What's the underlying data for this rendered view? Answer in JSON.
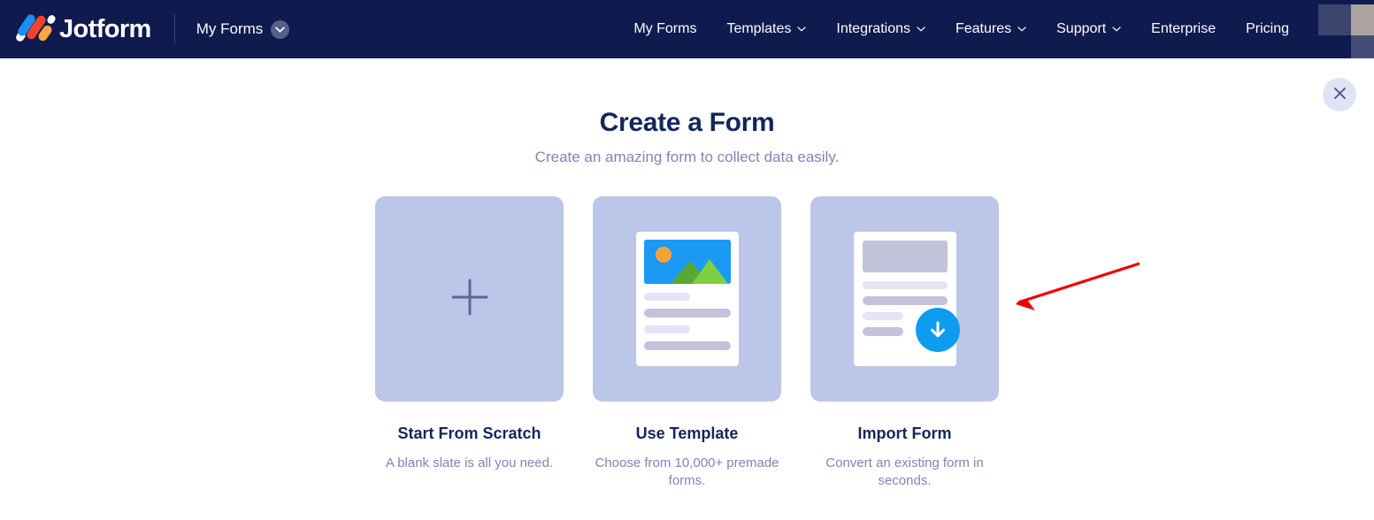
{
  "header": {
    "brand_name": "Jotform",
    "logo_icon": "jotform-logo-icon",
    "my_forms_label": "My Forms",
    "my_forms_chevron_icon": "chevron-down-icon",
    "avatar": "censored-avatar-block",
    "nav_items": [
      {
        "label": "My Forms",
        "has_chevron": false,
        "icon": ""
      },
      {
        "label": "Templates",
        "has_chevron": true,
        "icon": "chevron-down-icon"
      },
      {
        "label": "Integrations",
        "has_chevron": true,
        "icon": "chevron-down-icon"
      },
      {
        "label": "Features",
        "has_chevron": true,
        "icon": "chevron-down-icon"
      },
      {
        "label": "Support",
        "has_chevron": true,
        "icon": "chevron-down-icon"
      },
      {
        "label": "Enterprise",
        "has_chevron": false,
        "icon": ""
      },
      {
        "label": "Pricing",
        "has_chevron": false,
        "icon": ""
      }
    ]
  },
  "close_button": {
    "icon": "close-icon",
    "label": "Close"
  },
  "main": {
    "title": "Create a Form",
    "subtitle": "Create an amazing form to collect data easily.",
    "cards": [
      {
        "label": "Start From Scratch",
        "description": "A blank slate is all you need.",
        "icon": "plus-icon"
      },
      {
        "label": "Use Template",
        "description": "Choose from 10,000+ premade forms.",
        "icon": "template-page-icon"
      },
      {
        "label": "Import Form",
        "description": "Convert an existing form in seconds.",
        "icon": "import-download-icon"
      }
    ]
  },
  "annotation": {
    "type": "red-arrow",
    "points_to": "Import Form",
    "color": "#ee0000"
  },
  "colors": {
    "header_navy": "#0f1a4e",
    "card_periwinkle": "#bcc6e8",
    "title_navy": "#13265c",
    "muted_text": "#7d86b4",
    "accent_blue": "#0f9bf0",
    "page_background": "#ffffff",
    "annotation_red": "#ee0000"
  }
}
